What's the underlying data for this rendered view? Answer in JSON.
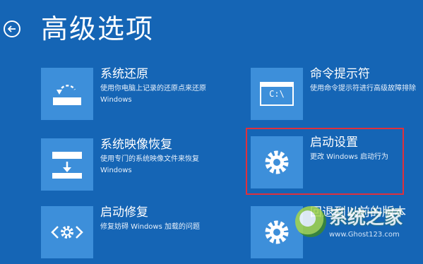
{
  "page": {
    "title": "高级选项"
  },
  "options": {
    "system_restore": {
      "name": "系统还原",
      "desc": "使用你电脑上记录的还原点来还原 Windows",
      "icon": "restore-icon"
    },
    "system_image": {
      "name": "系统映像恢复",
      "desc": "使用专门的系统映像文件来恢复 Windows",
      "icon": "drive-download-icon"
    },
    "startup_repair": {
      "name": "启动修复",
      "desc": "修复妨碍 Windows 加载的问题",
      "icon": "code-gear-icon"
    },
    "command_prompt": {
      "name": "命令提示符",
      "desc": "使用命令提示符进行高级故障排除",
      "icon": "command-prompt-icon",
      "tile_text": "C:\\"
    },
    "startup_settings": {
      "name": "启动设置",
      "desc": "更改 Windows 启动行为",
      "icon": "gear-icon"
    },
    "go_back": {
      "name": "回退到以前的版本",
      "desc": "",
      "icon": "gear-icon"
    }
  },
  "watermark": {
    "text": "系统之家",
    "url": "www.Ghost123.com"
  },
  "colors": {
    "background": "#1565b5",
    "tile": "#3d8fda",
    "highlight": "#e0303c"
  }
}
